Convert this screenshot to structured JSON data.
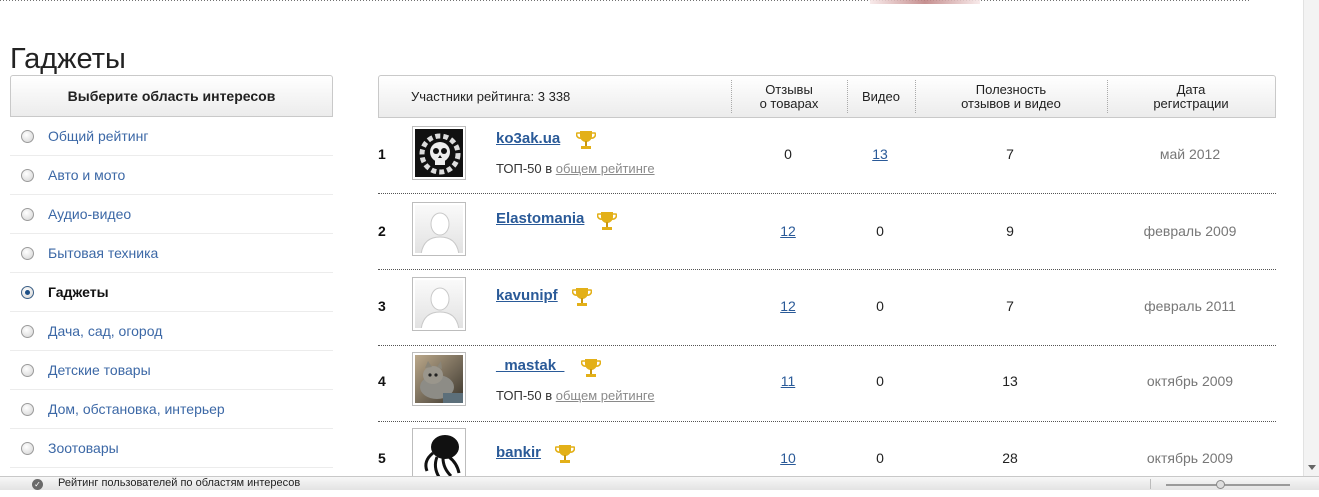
{
  "page": {
    "title": "Гаджеты"
  },
  "sidebar": {
    "heading": "Выберите область интересов",
    "items": [
      {
        "label": "Общий рейтинг",
        "selected": false
      },
      {
        "label": "Авто и мото",
        "selected": false
      },
      {
        "label": "Аудио-видео",
        "selected": false
      },
      {
        "label": "Бытовая техника",
        "selected": false
      },
      {
        "label": "Гаджеты",
        "selected": true
      },
      {
        "label": "Дача, сад, огород",
        "selected": false
      },
      {
        "label": "Детские товары",
        "selected": false
      },
      {
        "label": "Дом, обстановка, интерьер",
        "selected": false
      },
      {
        "label": "Зоотовары",
        "selected": false
      }
    ]
  },
  "table": {
    "header": {
      "members": "Участники рейтинга: 3 338",
      "reviews_line1": "Отзывы",
      "reviews_line2": "о товарах",
      "videos": "Видео",
      "useful_line1": "Полезность",
      "useful_line2": "отзывов и видео",
      "date_line1": "Дата",
      "date_line2": "регистрации"
    },
    "top50_prefix": "ТОП-50 в",
    "top50_link": "общем рейтинге",
    "rows": [
      {
        "rank": "1",
        "name": "ko3ak.ua",
        "avatar": "skull-gear",
        "top50": true,
        "reviews": "0",
        "reviews_link": false,
        "videos": "13",
        "videos_link": true,
        "usefulness": "7",
        "registered": "май 2012"
      },
      {
        "rank": "2",
        "name": "Elastomania",
        "avatar": "silhouette",
        "top50": false,
        "reviews": "12",
        "reviews_link": true,
        "videos": "0",
        "videos_link": false,
        "usefulness": "9",
        "registered": "февраль 2009"
      },
      {
        "rank": "3",
        "name": "kavunipf",
        "avatar": "silhouette",
        "top50": false,
        "reviews": "12",
        "reviews_link": true,
        "videos": "0",
        "videos_link": false,
        "usefulness": "7",
        "registered": "февраль 2011"
      },
      {
        "rank": "4",
        "name": "_mastak_",
        "avatar": "cat-photo",
        "top50": true,
        "reviews": "11",
        "reviews_link": true,
        "videos": "0",
        "videos_link": false,
        "usefulness": "13",
        "registered": "октябрь 2009"
      },
      {
        "rank": "5",
        "name": "bankir",
        "avatar": "octopus",
        "top50": false,
        "reviews": "10",
        "reviews_link": true,
        "videos": "0",
        "videos_link": false,
        "usefulness": "28",
        "registered": "октябрь 2009"
      }
    ]
  },
  "statusbar": {
    "text": "Рейтинг пользователей по областям интересов"
  },
  "colors": {
    "link": "#2a5a98",
    "trophy": "#e0a800",
    "muted": "#777777"
  }
}
